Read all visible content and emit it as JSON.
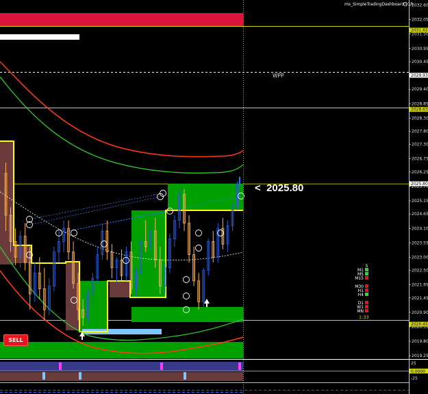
{
  "dashboard": {
    "title": "ms_SimpleTradingDashboard v1R",
    "price_callout": "<  2025.80",
    "wpp_label": "WPP",
    "sell_label": "SELL",
    "countdown": "1:33",
    "timeframes": [
      {
        "label": "M1",
        "value": "5",
        "color": "#22dd22"
      },
      {
        "label": "M5",
        "value": "",
        "color": "#22dd22"
      },
      {
        "label": "M15",
        "value": "",
        "color": "#e8141c"
      },
      {
        "label": "M30",
        "value": "",
        "color": "#e8141c"
      },
      {
        "label": "H1",
        "value": "",
        "color": "#e8141c"
      },
      {
        "label": "H4",
        "value": "",
        "color": "#22dd22"
      },
      {
        "label": "D1",
        "value": "",
        "color": "#e8141c"
      },
      {
        "label": "W1",
        "value": "",
        "color": "#e8141c"
      },
      {
        "label": "MN",
        "value": "",
        "color": "#e8141c"
      }
    ]
  },
  "price_axis": {
    "ticks": [
      "2032.60",
      "2032.05",
      "2031.50",
      "2030.95",
      "2030.45",
      "2029.93",
      "2029.40",
      "2028.85",
      "2028.30",
      "2027.80",
      "2027.30",
      "2026.75",
      "2026.25",
      "2025.70",
      "2025.15",
      "2024.65",
      "2024.10",
      "2023.55",
      "2023.00",
      "2022.50",
      "2021.95",
      "2021.45",
      "2020.90",
      "2020.35",
      "2019.80",
      "2019.25"
    ],
    "tick_values": [
      2032.6,
      2032.05,
      2031.5,
      2030.95,
      2030.45,
      2029.93,
      2029.4,
      2028.85,
      2028.3,
      2027.8,
      2027.3,
      2026.75,
      2026.25,
      2025.7,
      2025.15,
      2024.65,
      2024.1,
      2023.55,
      2023.0,
      2022.5,
      2021.95,
      2021.45,
      2020.9,
      2020.35,
      2019.8,
      2019.25
    ],
    "highlight_labels": [
      {
        "text": "2031.65",
        "value": 2031.65,
        "bg": "#d7d700",
        "fg": "#000000"
      },
      {
        "text": "2029.93",
        "value": 2029.93,
        "bg": "#ffffff",
        "fg": "#000000"
      },
      {
        "text": "2028.63",
        "value": 2028.63,
        "bg": "#d7d700",
        "fg": "#000000"
      },
      {
        "text": "2025.80",
        "value": 2025.8,
        "bg": "#ffffff",
        "fg": "#000000"
      },
      {
        "text": "2020.45",
        "value": 2020.45,
        "bg": "#d7d700",
        "fg": "#000000"
      }
    ],
    "range": [
      2019.2,
      2032.68
    ]
  },
  "oscillator_axis": {
    "ticks": [
      "25",
      "0.0000",
      "-25"
    ]
  },
  "colors": {
    "background": "#000000",
    "bull_candle": "#2a5bd7",
    "bear_candle": "#ffb15a",
    "green_zone": "#00a000",
    "brown_zone": "#6b3b3b",
    "red_band": "#dc143c",
    "yellow_line": "#ffff00",
    "envelope_upper": "#ff3b1a",
    "envelope_lower": "#2ed52e"
  },
  "chart_data": {
    "type": "candlestick",
    "symbol_price_current": 2025.8,
    "reference_levels": [
      2031.65,
      2029.93,
      2028.63,
      2025.8,
      2020.45
    ],
    "candles": [
      [
        2026.2,
        2026.6,
        2024.0,
        2024.6
      ],
      [
        2024.6,
        2024.9,
        2023.2,
        2023.6
      ],
      [
        2023.6,
        2024.1,
        2022.7,
        2023.0
      ],
      [
        2023.0,
        2024.0,
        2022.6,
        2023.8
      ],
      [
        2023.8,
        2024.3,
        2022.5,
        2022.8
      ],
      [
        2022.8,
        2023.4,
        2021.0,
        2021.6
      ],
      [
        2021.6,
        2022.8,
        2021.3,
        2022.4
      ],
      [
        2022.4,
        2023.0,
        2021.4,
        2021.8
      ],
      [
        2021.8,
        2022.6,
        2020.6,
        2021.0
      ],
      [
        2021.0,
        2022.2,
        2020.8,
        2021.9
      ],
      [
        2021.9,
        2023.4,
        2021.7,
        2023.2
      ],
      [
        2023.2,
        2024.0,
        2022.8,
        2023.6
      ],
      [
        2023.6,
        2024.4,
        2023.2,
        2024.1
      ],
      [
        2024.1,
        2024.4,
        2022.9,
        2023.2
      ],
      [
        2023.2,
        2023.6,
        2021.8,
        2022.0
      ],
      [
        2022.0,
        2022.4,
        2020.6,
        2021.0
      ],
      [
        2021.0,
        2021.4,
        2020.4,
        2020.7
      ],
      [
        2020.7,
        2021.8,
        2020.5,
        2021.6
      ],
      [
        2021.6,
        2022.4,
        2021.2,
        2022.2
      ],
      [
        2022.2,
        2023.4,
        2022.0,
        2023.1
      ],
      [
        2023.1,
        2024.3,
        2022.9,
        2024.0
      ],
      [
        2024.0,
        2024.4,
        2022.9,
        2023.2
      ],
      [
        2023.2,
        2023.5,
        2022.2,
        2022.6
      ],
      [
        2022.6,
        2023.0,
        2022.0,
        2022.9
      ],
      [
        2022.9,
        2023.3,
        2022.1,
        2022.3
      ],
      [
        2022.3,
        2023.4,
        2022.1,
        2023.2
      ],
      [
        2023.2,
        2023.6,
        2021.6,
        2021.8
      ],
      [
        2021.8,
        2022.6,
        2021.5,
        2022.4
      ],
      [
        2022.4,
        2023.8,
        2022.2,
        2023.6
      ],
      [
        2023.6,
        2024.4,
        2023.2,
        2023.4
      ],
      [
        2023.4,
        2024.2,
        2023.0,
        2024.0
      ],
      [
        2024.0,
        2024.5,
        2022.6,
        2022.9
      ],
      [
        2022.9,
        2023.4,
        2021.6,
        2021.9
      ],
      [
        2021.9,
        2022.8,
        2021.6,
        2022.6
      ],
      [
        2022.6,
        2023.9,
        2022.4,
        2023.7
      ],
      [
        2023.7,
        2024.6,
        2023.4,
        2024.4
      ],
      [
        2024.4,
        2025.6,
        2024.1,
        2025.4
      ],
      [
        2025.4,
        2025.6,
        2024.0,
        2024.3
      ],
      [
        2024.3,
        2024.6,
        2022.8,
        2023.1
      ],
      [
        2023.1,
        2023.4,
        2021.9,
        2022.1
      ],
      [
        2022.1,
        2022.4,
        2021.0,
        2021.3
      ],
      [
        2021.3,
        2022.6,
        2021.1,
        2022.5
      ],
      [
        2022.5,
        2023.7,
        2022.3,
        2023.6
      ],
      [
        2023.6,
        2024.0,
        2022.8,
        2023.0
      ],
      [
        2023.0,
        2024.3,
        2022.8,
        2024.1
      ],
      [
        2024.1,
        2024.5,
        2023.3,
        2023.5
      ],
      [
        2023.5,
        2024.4,
        2023.2,
        2024.2
      ],
      [
        2024.2,
        2025.1,
        2024.0,
        2025.0
      ],
      [
        2025.0,
        2025.9,
        2024.8,
        2025.8
      ]
    ]
  }
}
